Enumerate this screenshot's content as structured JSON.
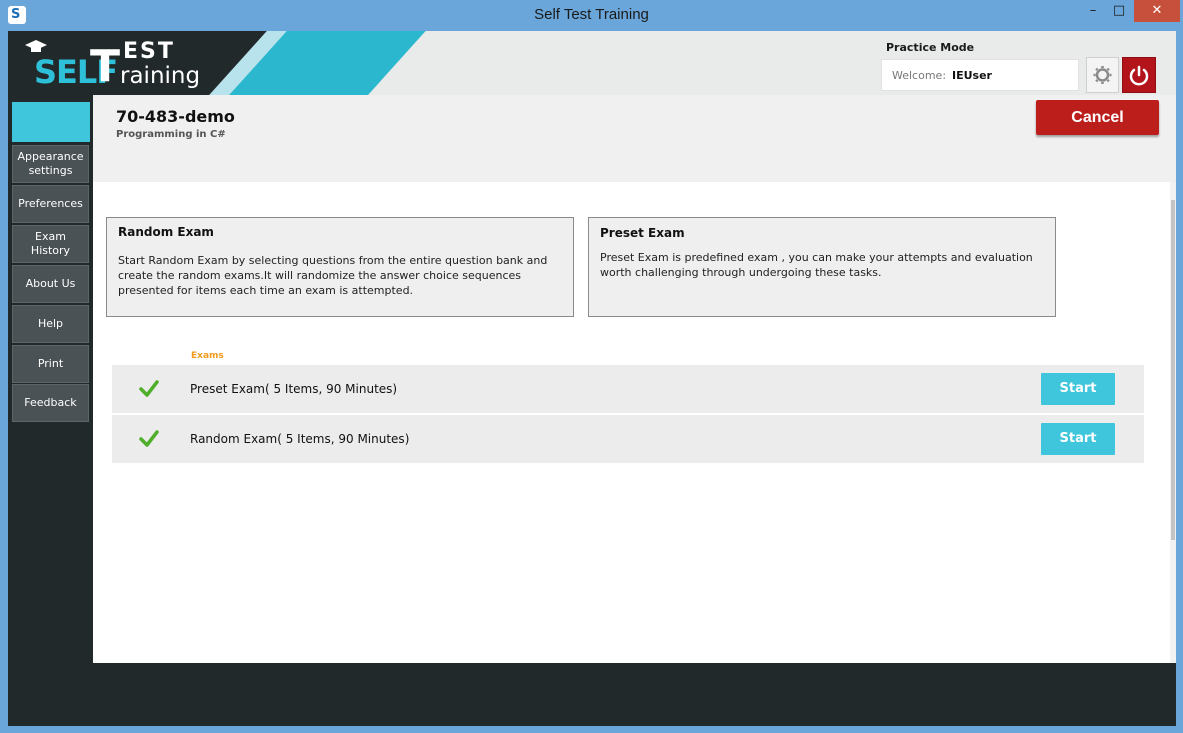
{
  "window": {
    "title": "Self Test Training",
    "minimize": "–",
    "maximize": "□",
    "close": "✕"
  },
  "brand": {
    "logo_self": "SELF",
    "logo_t": "T",
    "logo_est": "EST",
    "logo_raining": "raining"
  },
  "header": {
    "mode": "Practice Mode",
    "welcome_label": "Welcome:",
    "username": "IEUser",
    "gear_icon": "gear-icon",
    "power_icon": "power-icon"
  },
  "sidebar": {
    "items": [
      {
        "label": "Appearance settings"
      },
      {
        "label": "Preferences"
      },
      {
        "label": "Exam History"
      },
      {
        "label": "About Us"
      },
      {
        "label": "Help"
      },
      {
        "label": "Print"
      },
      {
        "label": "Feedback"
      }
    ]
  },
  "exam": {
    "code": "70-483-demo",
    "subtitle": "Programming in C#",
    "cancel": "Cancel"
  },
  "cards": {
    "random": {
      "title": "Random Exam",
      "body": "Start Random Exam by selecting questions from the entire question bank and create the random exams.It will  randomize the answer choice sequences presented for items each time an exam is attempted."
    },
    "preset": {
      "title": "Preset Exam",
      "body": "Preset Exam is predefined exam , you can make your attempts and evaluation worth challenging through undergoing these tasks."
    }
  },
  "exams_list": {
    "heading": "Exams",
    "rows": [
      {
        "name": "Preset Exam( 5 Items, 90 Minutes)",
        "action": "Start"
      },
      {
        "name": "Random Exam( 5 Items, 90 Minutes)",
        "action": "Start"
      }
    ]
  },
  "colors": {
    "accent": "#3fc6dc",
    "danger": "#bc1f1b",
    "exams_heading": "#f29a1c"
  }
}
